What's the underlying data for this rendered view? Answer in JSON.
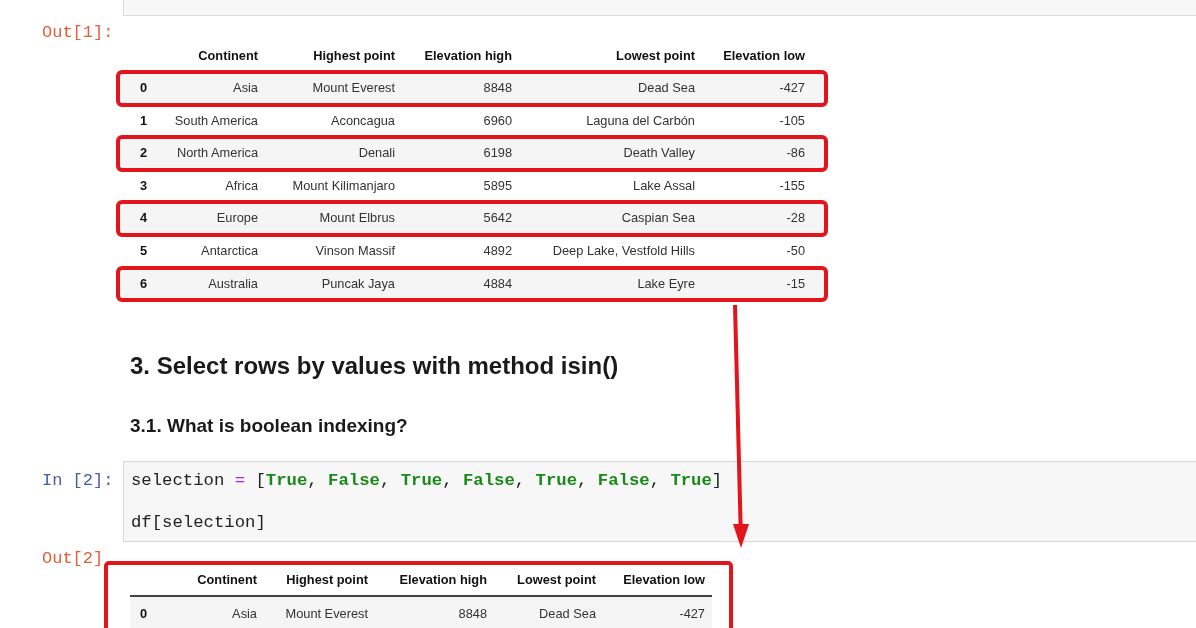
{
  "cells": [
    {
      "kind": "output",
      "prompt": "Out[1]:",
      "table": {
        "columns": [
          "Continent",
          "Highest point",
          "Elevation high",
          "Lowest point",
          "Elevation low"
        ],
        "rows": [
          {
            "index": "0",
            "values": [
              "Asia",
              "Mount Everest",
              "8848",
              "Dead Sea",
              "-427"
            ],
            "highlighted": true
          },
          {
            "index": "1",
            "values": [
              "South America",
              "Aconcagua",
              "6960",
              "Laguna del Carbón",
              "-105"
            ],
            "highlighted": false
          },
          {
            "index": "2",
            "values": [
              "North America",
              "Denali",
              "6198",
              "Death Valley",
              "-86"
            ],
            "highlighted": true
          },
          {
            "index": "3",
            "values": [
              "Africa",
              "Mount Kilimanjaro",
              "5895",
              "Lake Assal",
              "-155"
            ],
            "highlighted": false
          },
          {
            "index": "4",
            "values": [
              "Europe",
              "Mount Elbrus",
              "5642",
              "Caspian Sea",
              "-28"
            ],
            "highlighted": true
          },
          {
            "index": "5",
            "values": [
              "Antarctica",
              "Vinson Massif",
              "4892",
              "Deep Lake, Vestfold Hills",
              "-50"
            ],
            "highlighted": false
          },
          {
            "index": "6",
            "values": [
              "Australia",
              "Puncak Jaya",
              "4884",
              "Lake Eyre",
              "-15"
            ],
            "highlighted": true
          }
        ]
      }
    },
    {
      "kind": "title",
      "text": "3. Select rows by values with method isin()"
    },
    {
      "kind": "subtitle",
      "text": "3.1. What is boolean indexing?"
    },
    {
      "kind": "input",
      "prompt": "In [2]:",
      "lines": [
        {
          "tokens": [
            {
              "text": "selection ",
              "kind": "name"
            },
            {
              "text": "=",
              "kind": "operator"
            },
            {
              "text": " [",
              "kind": "punct"
            },
            {
              "text": "True",
              "kind": "constant"
            },
            {
              "text": ", ",
              "kind": "punct"
            },
            {
              "text": "False",
              "kind": "constant"
            },
            {
              "text": ", ",
              "kind": "punct"
            },
            {
              "text": "True",
              "kind": "constant"
            },
            {
              "text": ", ",
              "kind": "punct"
            },
            {
              "text": "False",
              "kind": "constant"
            },
            {
              "text": ", ",
              "kind": "punct"
            },
            {
              "text": "True",
              "kind": "constant"
            },
            {
              "text": ", ",
              "kind": "punct"
            },
            {
              "text": "False",
              "kind": "constant"
            },
            {
              "text": ", ",
              "kind": "punct"
            },
            {
              "text": "True",
              "kind": "constant"
            },
            {
              "text": "]",
              "kind": "punct"
            }
          ]
        },
        {
          "tokens": [
            {
              "text": "df[selection]",
              "kind": "name"
            }
          ]
        }
      ]
    },
    {
      "kind": "output",
      "prompt": "Out[2]",
      "framed": true,
      "table": {
        "header_rule": true,
        "columns": [
          "Continent",
          "Highest point",
          "Elevation high",
          "Lowest point",
          "Elevation low"
        ],
        "rows": [
          {
            "index": "0",
            "values": [
              "Asia",
              "Mount Everest",
              "8848",
              "Dead Sea",
              "-427"
            ],
            "highlighted": false
          }
        ]
      }
    }
  ]
}
